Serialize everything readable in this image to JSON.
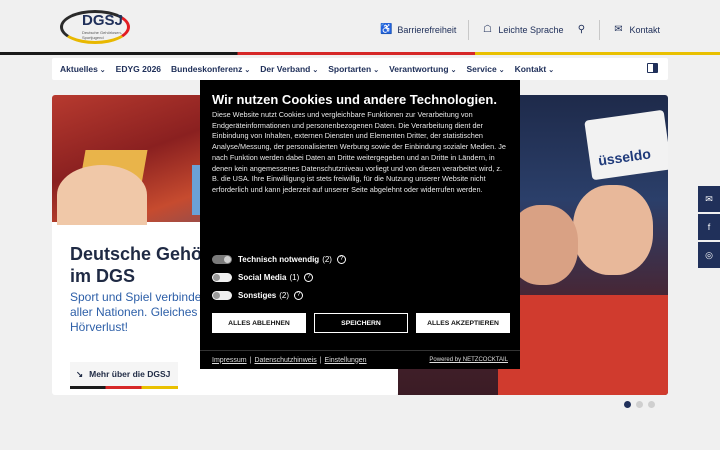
{
  "header": {
    "logo_text": "DGSJ",
    "logo_sub": "Deutsche Gehörlosen-Sportjugend",
    "links": [
      {
        "label": "Barrierefreiheit",
        "icon": "accessibility-icon"
      },
      {
        "label": "Leichte Sprache",
        "icon": "easy-language-icon"
      },
      {
        "label": "",
        "icon": "search-icon"
      },
      {
        "label": "Kontakt",
        "icon": "mail-icon"
      }
    ]
  },
  "nav": {
    "items": [
      "Aktuelles",
      "EDYG 2026",
      "Bundeskonferenz",
      "Der Verband",
      "Sportarten",
      "Verantwortung",
      "Service",
      "Kontakt"
    ],
    "has_chevron": [
      true,
      false,
      true,
      true,
      true,
      true,
      true,
      true
    ]
  },
  "hero": {
    "title": "Deutsche Gehörlosen-Sport-jugend im DGS",
    "text": "Sport und Spiel verbinden Menschen aller Religionen und aller Nationen. Gleiches gilt für Menschen mit und ohne Hörverlust!",
    "button": "Mehr über die DGSJ",
    "right_image_text": "üsseldo",
    "slides": 3,
    "active_slide": 1
  },
  "side_buttons": [
    "newsletter-icon",
    "facebook-icon",
    "instagram-icon"
  ],
  "cookie": {
    "title": "Wir nutzen Cookies und andere Technologien.",
    "body": "Diese Website nutzt Cookies und vergleichbare Funktionen zur Verarbeitung von Endgeräteinformationen und personenbezogenen Daten. Die Verarbeitung dient der Einbindung von Inhalten, externen Diensten und Elementen Dritter, der statistischen Analyse/Messung, der personalisierten Werbung sowie der Einbindung sozialer Medien. Je nach Funktion werden dabei Daten an Dritte weitergegeben und an Dritte in Ländern, in denen kein angemessenes Datenschutzniveau vorliegt und von diesen verarbeitet wird, z. B. die USA. Ihre Einwilligung ist stets freiwillig, für die Nutzung unserer Website nicht erforderlich und kann jederzeit auf unserer Seite abgelehnt oder widerrufen werden.",
    "toggles": [
      {
        "label": "Technisch notwendig",
        "count": "(2)",
        "on": true
      },
      {
        "label": "Social Media",
        "count": "(1)",
        "on": false
      },
      {
        "label": "Sonstiges",
        "count": "(2)",
        "on": false
      }
    ],
    "buttons": {
      "reject": "ALLES ABLEHNEN",
      "save": "SPEICHERN",
      "accept": "ALLES AKZEPTIEREN"
    },
    "footer": {
      "impressum": "Impressum",
      "datenschutz": "Datenschutzhinweis",
      "einstellungen": "Einstellungen",
      "powered": "Powered by NETZCOCKTAIL"
    }
  }
}
